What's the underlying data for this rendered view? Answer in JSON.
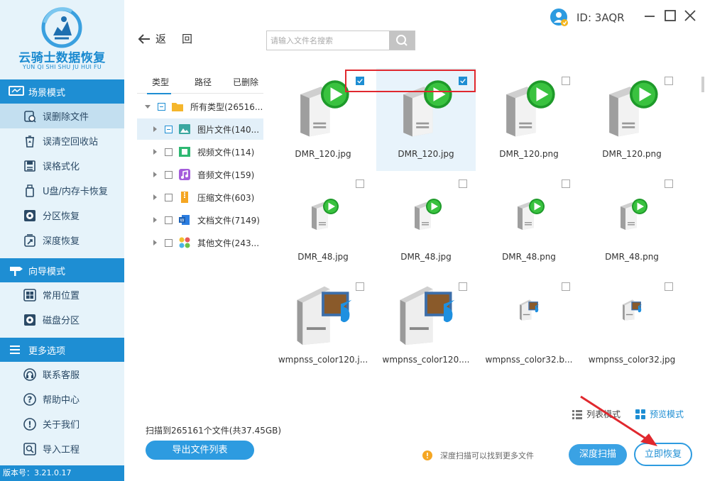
{
  "app": {
    "title": "云骑士数据恢复",
    "subtitle": "YUN QI SHI SHU JU HUI FU",
    "version": "版本号：3.21.0.17",
    "user_id": "ID: 3AQR",
    "accent": "#1e8ed3"
  },
  "sidebar": {
    "sections": [
      {
        "header": "场景模式",
        "icon": "monitor-icon",
        "items": [
          {
            "label": "误删除文件",
            "icon": "deleted-file-icon",
            "active": true
          },
          {
            "label": "误清空回收站",
            "icon": "recycle-bin-icon"
          },
          {
            "label": "误格式化",
            "icon": "format-disk-icon"
          },
          {
            "label": "U盘/内存卡恢复",
            "icon": "usb-drive-icon"
          },
          {
            "label": "分区恢复",
            "icon": "partition-icon"
          },
          {
            "label": "深度恢复",
            "icon": "deep-recover-icon"
          }
        ]
      },
      {
        "header": "向导模式",
        "icon": "signpost-icon",
        "items": [
          {
            "label": "常用位置",
            "icon": "windows-icon"
          },
          {
            "label": "磁盘分区",
            "icon": "disk-icon"
          }
        ]
      },
      {
        "header": "更多选项",
        "icon": "menu-icon",
        "items": [
          {
            "label": "联系客服",
            "icon": "headset-icon"
          },
          {
            "label": "帮助中心",
            "icon": "question-icon"
          },
          {
            "label": "关于我们",
            "icon": "info-icon"
          },
          {
            "label": "导入工程",
            "icon": "import-icon"
          }
        ]
      }
    ]
  },
  "toolbar": {
    "back_label": "返回",
    "search_placeholder": "请输入文件名搜索"
  },
  "tree": {
    "tabs": [
      "类型",
      "路径",
      "已删除"
    ],
    "rows": [
      {
        "label": "所有类型(26516...",
        "icon": "folder-icon",
        "expanded": true,
        "check": "partial"
      },
      {
        "label": "图片文件(140...",
        "icon": "image-icon",
        "check": "partial",
        "selected": true
      },
      {
        "label": "视频文件(114)",
        "icon": "video-icon",
        "check": "none"
      },
      {
        "label": "音频文件(159)",
        "icon": "audio-icon",
        "check": "none"
      },
      {
        "label": "压缩文件(603)",
        "icon": "archive-icon",
        "check": "none"
      },
      {
        "label": "文档文件(7149)",
        "icon": "document-icon",
        "check": "none"
      },
      {
        "label": "其他文件(243...",
        "icon": "other-icon",
        "check": "none"
      }
    ]
  },
  "grid": {
    "files": [
      {
        "name": "DMR_120.jpg",
        "thumb": "media-server-play-icon",
        "checked": true
      },
      {
        "name": "DMR_120.jpg",
        "thumb": "media-server-play-icon",
        "checked": true,
        "selected": true
      },
      {
        "name": "DMR_120.png",
        "thumb": "media-server-play-icon",
        "checked": false
      },
      {
        "name": "DMR_120.png",
        "thumb": "media-server-play-icon",
        "checked": false
      },
      {
        "name": "DMR_48.jpg",
        "thumb": "media-server-play-small-icon",
        "checked": false
      },
      {
        "name": "DMR_48.jpg",
        "thumb": "media-server-play-small-icon",
        "checked": false
      },
      {
        "name": "DMR_48.png",
        "thumb": "media-server-play-small-icon",
        "checked": false
      },
      {
        "name": "DMR_48.png",
        "thumb": "media-server-play-small-icon",
        "checked": false
      },
      {
        "name": "wmpnss_color120.j...",
        "thumb": "wmp-server-icon",
        "checked": false
      },
      {
        "name": "wmpnss_color120....",
        "thumb": "wmp-server-icon",
        "checked": false
      },
      {
        "name": "wmpnss_color32.b...",
        "thumb": "wmp-server-small-icon",
        "checked": false
      },
      {
        "name": "wmpnss_color32.jpg",
        "thumb": "wmp-server-small-icon",
        "checked": false
      }
    ]
  },
  "footer": {
    "list_mode": "列表模式",
    "preview_mode": "预览模式",
    "scan_summary": "扫描到265161个文件(共37.45GB)",
    "export_button": "导出文件列表",
    "hint": "深度扫描可以找到更多文件",
    "deep_scan_button": "深度扫描",
    "recover_button": "立即恢复"
  }
}
